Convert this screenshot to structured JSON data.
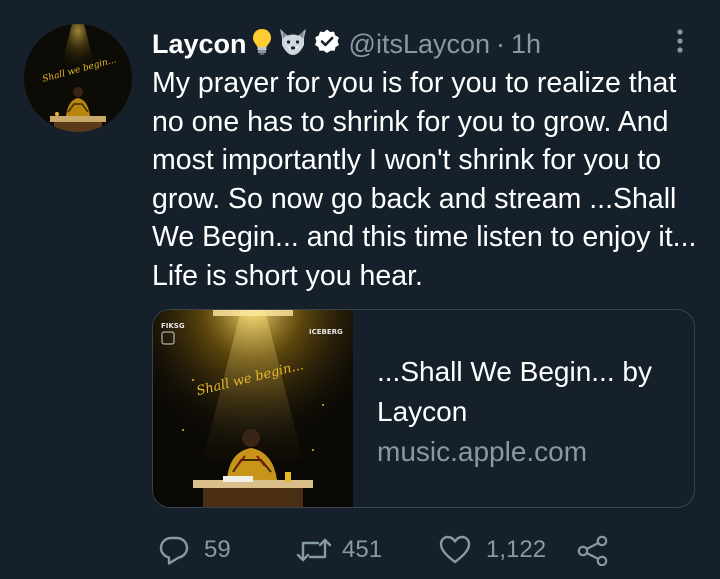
{
  "tweet": {
    "author_name": "Laycon",
    "handle": "@itsLaycon",
    "separator": "·",
    "time": "1h",
    "text": "My prayer for you is for you to realize that no one has to shrink for you to grow. And most importantly I won't shrink for you to grow. So now go back and stream ...Shall We Begin... and this time listen to enjoy it... Life is short you hear.",
    "emojis": [
      "light-bulb-icon",
      "wolf-face-icon"
    ],
    "verified_badge": "verified-badge-icon"
  },
  "avatar": {
    "cover_text": "Shall we begin..."
  },
  "card": {
    "title": "...Shall We Begin... by Laycon",
    "domain": "music.apple.com",
    "image_script_text": "Shall we begin...",
    "image_logo_left": "FIKSG",
    "image_logo_right": "ICEBERG"
  },
  "actions": {
    "reply_count": "59",
    "retweet_count": "451",
    "like_count": "1,122"
  },
  "colors": {
    "background": "#15202b",
    "text": "#ffffff",
    "secondary": "#8899a6",
    "border": "#38444d",
    "gold": "#e8b82a"
  }
}
